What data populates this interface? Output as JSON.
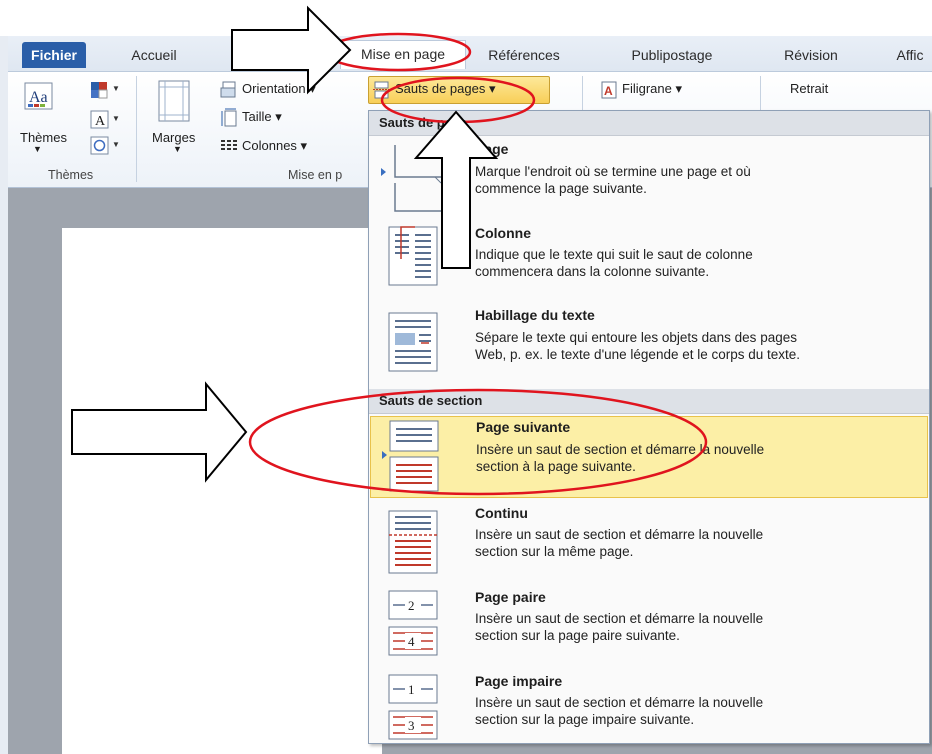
{
  "tabs": [
    "Fichier",
    "Accueil",
    "Mise en page",
    "Références",
    "Publipostage",
    "Révision",
    "Affic"
  ],
  "active_tab": "Mise en page",
  "ribbon": {
    "themes_label": "Thèmes",
    "themes_group": "Thèmes",
    "margins_label": "Marges",
    "orientation_label": "Orientation ▾",
    "size_label": "Taille ▾",
    "columns_label": "Colonnes ▾",
    "page_setup_group": "Mise en p",
    "breaks_label": "Sauts de pages ▾",
    "watermark_label": "Filigrane ▾",
    "indent_label": "Retrait"
  },
  "menu": {
    "page_breaks_header": "Sauts de page",
    "section_breaks_header": "Sauts de section",
    "items": [
      {
        "title": "Page",
        "desc": [
          "Marque l'endroit où se termine une page et où",
          "commence la page suivante."
        ]
      },
      {
        "title": "Colonne",
        "desc": [
          "Indique que le texte qui suit le saut de colonne",
          "commencera dans la colonne suivante."
        ]
      },
      {
        "title": "Habillage du texte",
        "desc": [
          "Sépare le texte qui entoure les objets dans des pages",
          "Web, p. ex. le texte d'une légende et le corps du texte."
        ]
      },
      {
        "title": "Page suivante",
        "desc": [
          "Insère un saut de section et démarre la nouvelle",
          "section à la page suivante."
        ]
      },
      {
        "title": "Continu",
        "desc": [
          "Insère un saut de section et démarre la nouvelle",
          "section sur la même page."
        ]
      },
      {
        "title": "Page paire",
        "desc": [
          "Insère un saut de section et démarre la nouvelle",
          "section sur la page paire suivante."
        ]
      },
      {
        "title": "Page impaire",
        "desc": [
          "Insère un saut de section et démarre la nouvelle",
          "section sur la page impaire suivante."
        ]
      }
    ],
    "even_page_icon_num1": "2",
    "even_page_icon_num2": "4",
    "odd_page_icon_num1": "1",
    "odd_page_icon_num2": "3"
  },
  "colors": {
    "file_tab": "#2a5ea8",
    "highlight": "#fcefa6",
    "annotation_red": "#e0141e"
  }
}
